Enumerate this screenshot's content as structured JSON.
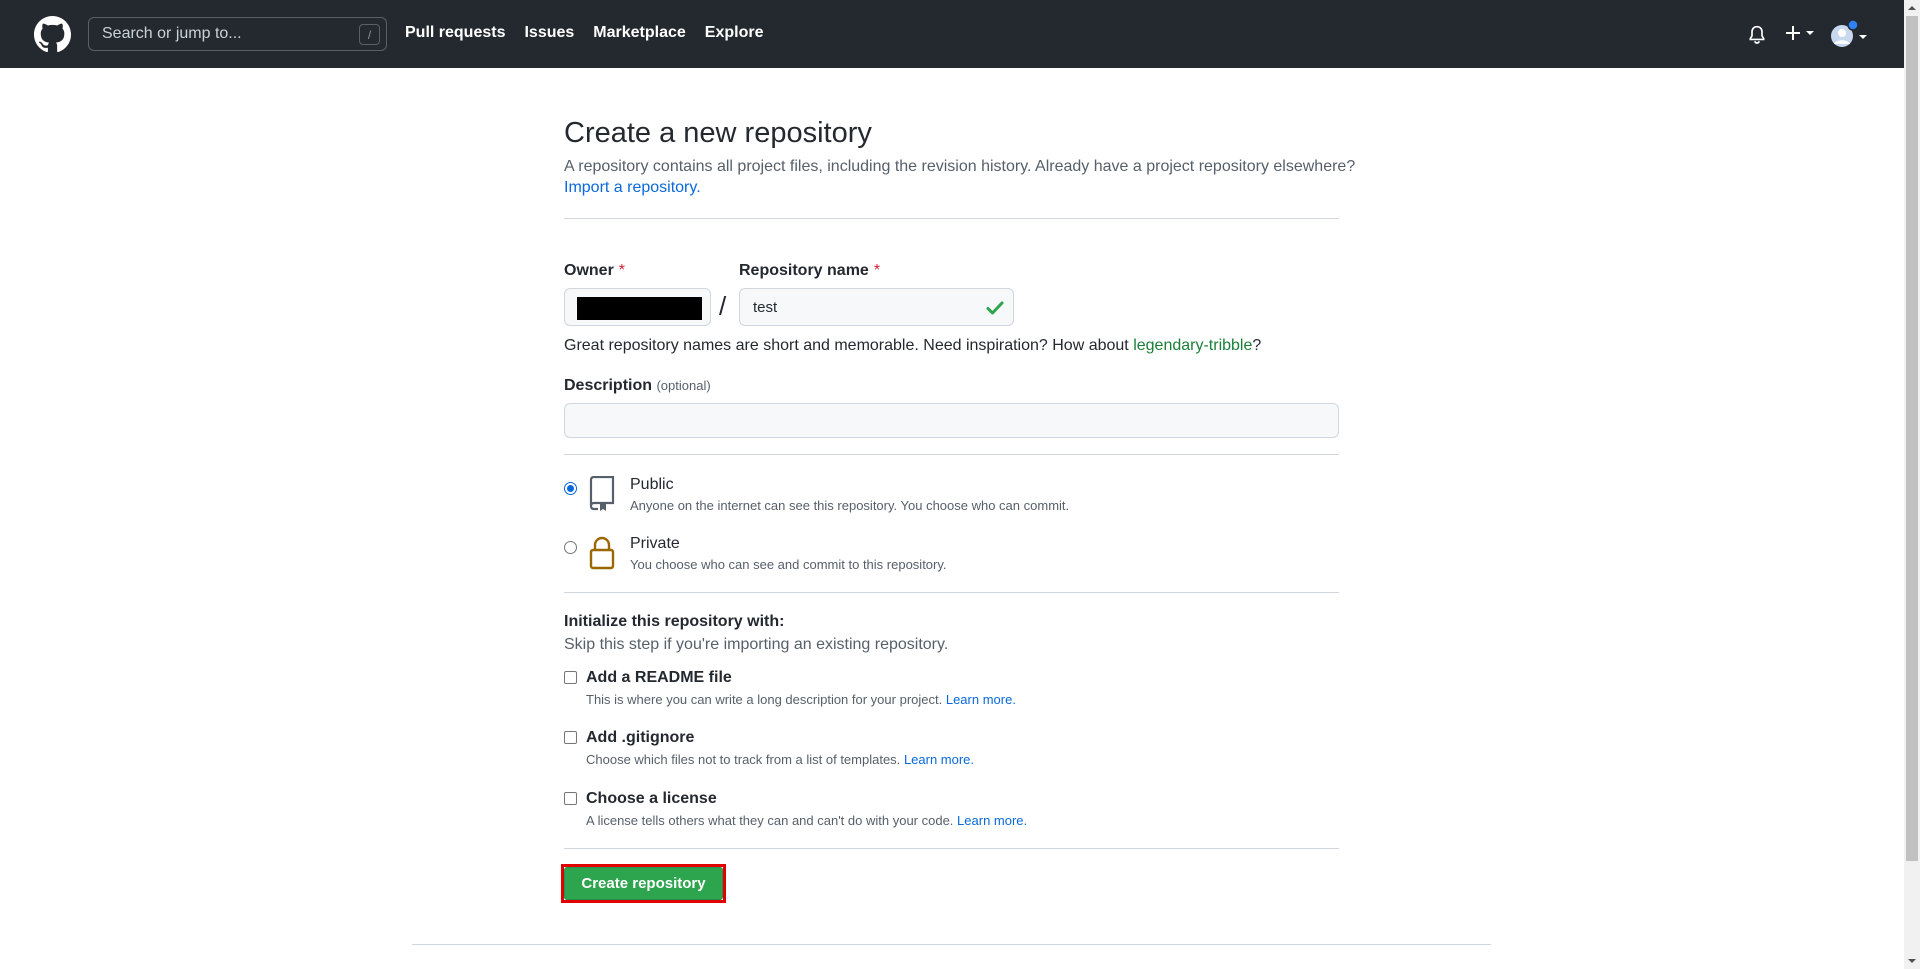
{
  "header": {
    "search_placeholder": "Search or jump to...",
    "search_shortcut": "/",
    "nav": [
      "Pull requests",
      "Issues",
      "Marketplace",
      "Explore"
    ]
  },
  "page": {
    "title": "Create a new repository",
    "subtitle": "A repository contains all project files, including the revision history. Already have a project repository elsewhere?",
    "import_link": "Import a repository."
  },
  "form": {
    "owner_label": "Owner",
    "required_mark": "*",
    "repo_label": "Repository name",
    "repo_value": "test",
    "separator": "/",
    "hint_prefix": "Great repository names are short and memorable. Need inspiration? How about ",
    "hint_suggestion": "legendary-tribble",
    "hint_suffix": "?",
    "description_label": "Description",
    "description_optional": "(optional)"
  },
  "visibility": {
    "public_title": "Public",
    "public_desc": "Anyone on the internet can see this repository. You choose who can commit.",
    "private_title": "Private",
    "private_desc": "You choose who can see and commit to this repository.",
    "selected": "Public"
  },
  "init": {
    "title": "Initialize this repository with:",
    "subtitle": "Skip this step if you're importing an existing repository.",
    "readme_title": "Add a README file",
    "readme_desc": "This is where you can write a long description for your project.",
    "gitignore_title": "Add .gitignore",
    "gitignore_desc": "Choose which files not to track from a list of templates.",
    "license_title": "Choose a license",
    "license_desc": "A license tells others what they can and can't do with your code.",
    "learn_more": "Learn more."
  },
  "actions": {
    "create_label": "Create repository"
  },
  "colors": {
    "header_bg": "#24292f",
    "link": "#0969da",
    "primary_green": "#2da44e",
    "required_red": "#cf222e",
    "highlight_outline": "#e00000"
  }
}
